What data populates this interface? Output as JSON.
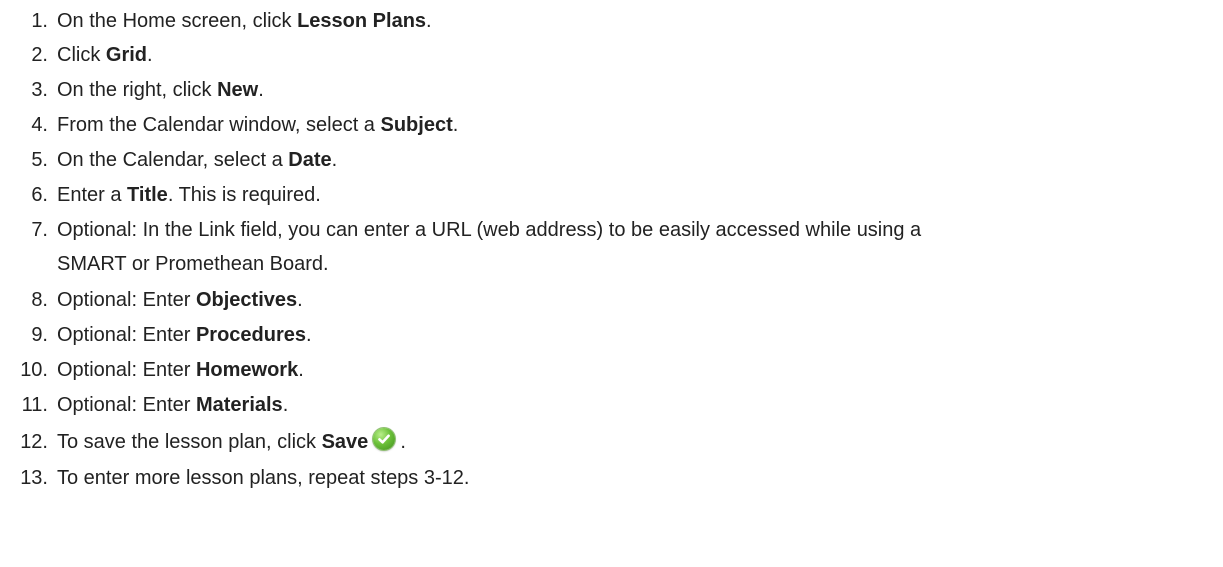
{
  "steps": [
    {
      "number": "1.",
      "pre": "On the Home screen, click ",
      "bold": "Lesson Plans",
      "post": "."
    },
    {
      "number": "2.",
      "pre": "Click ",
      "bold": "Grid",
      "post": "."
    },
    {
      "number": "3.",
      "pre": "On the right, click ",
      "bold": "New",
      "post": "."
    },
    {
      "number": "4.",
      "pre": "From the Calendar window, select a ",
      "bold": "Subject",
      "post": "."
    },
    {
      "number": "5.",
      "pre": "On the Calendar, select a ",
      "bold": "Date",
      "post": "."
    },
    {
      "number": "6.",
      "pre": "Enter a ",
      "bold": "Title",
      "post": ". This is required."
    },
    {
      "number": "7.",
      "line1": "Optional: In the Link field, you can enter a URL (web address) to be easily accessed while using a",
      "line2": "SMART or Promethean Board."
    },
    {
      "number": "8.",
      "pre": "Optional: Enter ",
      "bold": "Objectives",
      "post": "."
    },
    {
      "number": "9.",
      "pre": "Optional: Enter ",
      "bold": "Procedures",
      "post": "."
    },
    {
      "number": "10.",
      "pre": "Optional: Enter ",
      "bold": "Homework",
      "post": "."
    },
    {
      "number": "11.",
      "pre": "Optional: Enter ",
      "bold": "Materials",
      "post": "."
    },
    {
      "number": "12.",
      "pre": "To save the lesson plan, click ",
      "bold": "Save",
      "post": "."
    },
    {
      "number": "13.",
      "pre": "To enter more lesson plans, repeat steps 3-12."
    }
  ],
  "icons": {
    "save": "checkmark-icon",
    "save_color": "#5cb82e"
  }
}
